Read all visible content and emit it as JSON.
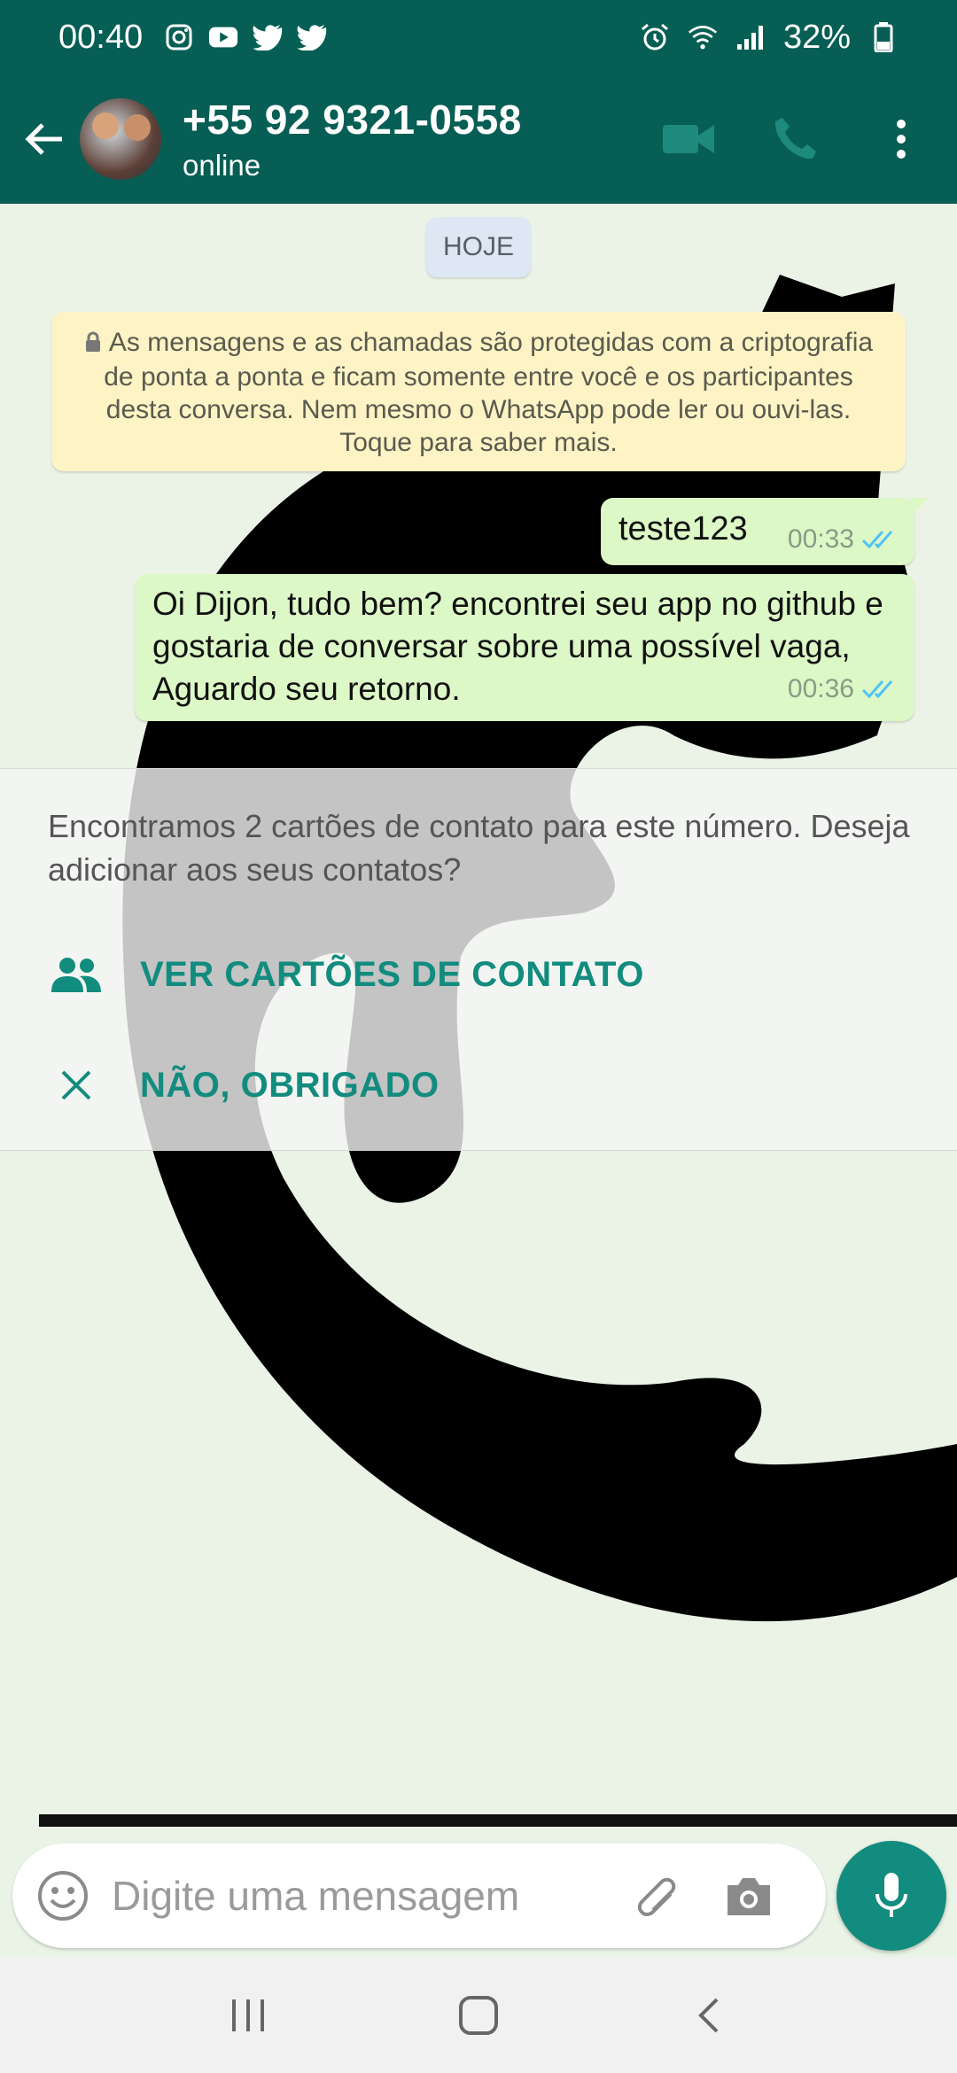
{
  "status_bar": {
    "time": "00:40",
    "battery": "32%",
    "app_icons": [
      "instagram-icon",
      "youtube-icon",
      "twitter-icon",
      "twitter-icon"
    ],
    "system_icons": [
      "alarm-icon",
      "wifi-icon",
      "signal-icon",
      "battery-icon"
    ]
  },
  "header": {
    "contact_name": "+55 92 9321-0558",
    "contact_status": "online",
    "icons": [
      "back-arrow-icon",
      "video-call-icon",
      "phone-icon",
      "more-vert-icon"
    ]
  },
  "chat": {
    "date_chip": "HOJE",
    "e2e_notice": "As mensagens e as chamadas são protegidas com a criptografia de ponta a ponta e ficam somente entre você e os participantes desta conversa. Nem mesmo o WhatsApp pode ler ou ouvi-las. Toque para saber mais.",
    "messages": [
      {
        "text": "teste123",
        "time": "00:33",
        "status": "read"
      },
      {
        "text": "Oi Dijon, tudo bem? encontrei seu app no github e gostaria de conversar sobre uma possível vaga, Aguardo seu retorno.",
        "time": "00:36",
        "status": "read"
      }
    ]
  },
  "contact_prompt": {
    "text": "Encontramos 2 cartões de contato para este número. Deseja adicionar aos seus contatos?",
    "view_contacts_label": "VER CARTÕES DE CONTATO",
    "dismiss_label": "NÃO, OBRIGADO"
  },
  "input_bar": {
    "placeholder": "Digite uma mensagem"
  },
  "colors": {
    "header": "#075e54",
    "accent": "#128c7e",
    "outgoing_bubble": "#dcf8c6",
    "notice_bg": "#fdf3c5",
    "read_ticks": "#4fc3f7"
  }
}
